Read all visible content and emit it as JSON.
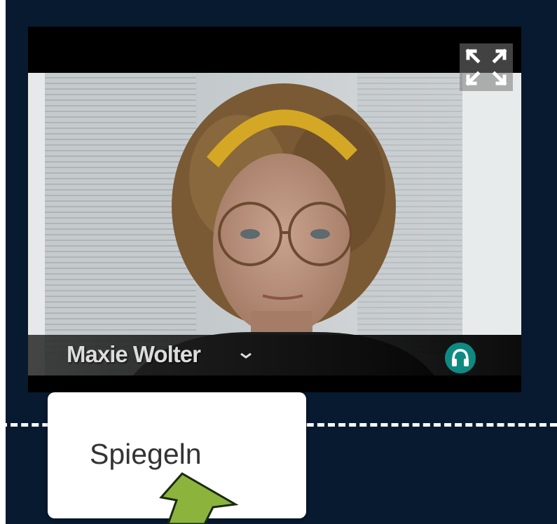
{
  "participant": {
    "name": "Maxie Wolter"
  },
  "context_menu": {
    "items": [
      {
        "label": "Spiegeln"
      }
    ]
  },
  "icons": {
    "fullscreen": "expand-icon",
    "chevron": "chevron-down-icon",
    "audio": "headset-icon",
    "pointer": "arrow-annotation"
  },
  "colors": {
    "background": "#081a30",
    "headset_badge": "#0e8a83",
    "arrow": "#8cb43c"
  }
}
